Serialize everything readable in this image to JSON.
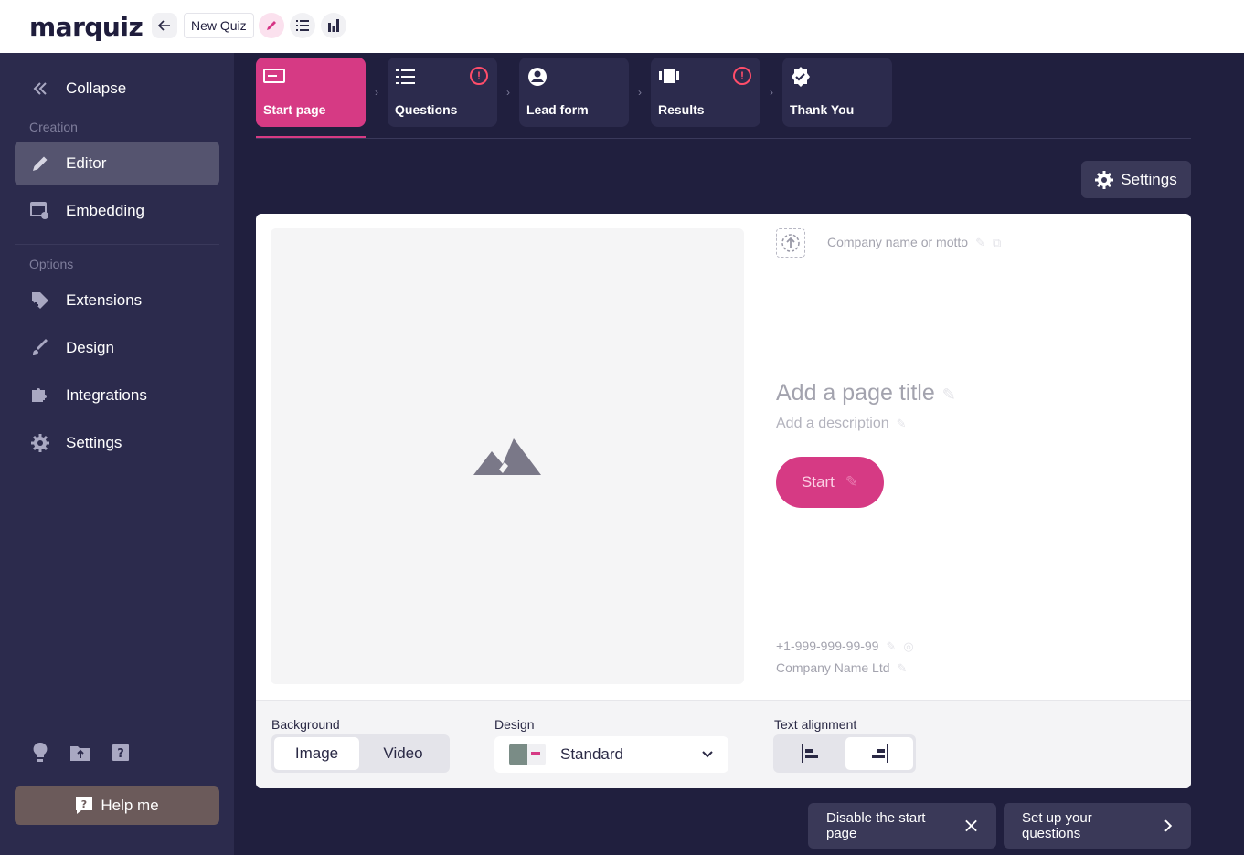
{
  "app": {
    "logo": "marquiz",
    "quiz_name": "New Quiz"
  },
  "sidebar": {
    "collapse_label": "Collapse",
    "section_creation": "Creation",
    "section_options": "Options",
    "items": [
      {
        "label": "Editor"
      },
      {
        "label": "Embedding"
      },
      {
        "label": "Extensions"
      },
      {
        "label": "Design"
      },
      {
        "label": "Integrations"
      },
      {
        "label": "Settings"
      }
    ],
    "help_label": "Help me"
  },
  "steps": [
    {
      "label": "Start page",
      "active": true
    },
    {
      "label": "Questions",
      "warning": true
    },
    {
      "label": "Lead form"
    },
    {
      "label": "Results",
      "warning": true
    },
    {
      "label": "Thank You"
    }
  ],
  "settings_label": "Settings",
  "start_page": {
    "motto_placeholder": "Company name or motto",
    "title_placeholder": "Add a page title",
    "description_placeholder": "Add a description",
    "start_button": "Start",
    "phone": "+1-999-999-99-99",
    "company": "Company Name Ltd"
  },
  "footer": {
    "background_label": "Background",
    "background_options": [
      "Image",
      "Video"
    ],
    "background_selected": "Image",
    "design_label": "Design",
    "design_value": "Standard",
    "alignment_label": "Text alignment"
  },
  "actions": {
    "disable_start": "Disable the start page",
    "next": "Set up your questions"
  },
  "colors": {
    "accent": "#d63a84",
    "sidebar": "#2c2b4d",
    "background": "#201f3e",
    "warning": "#ff4d6a"
  }
}
